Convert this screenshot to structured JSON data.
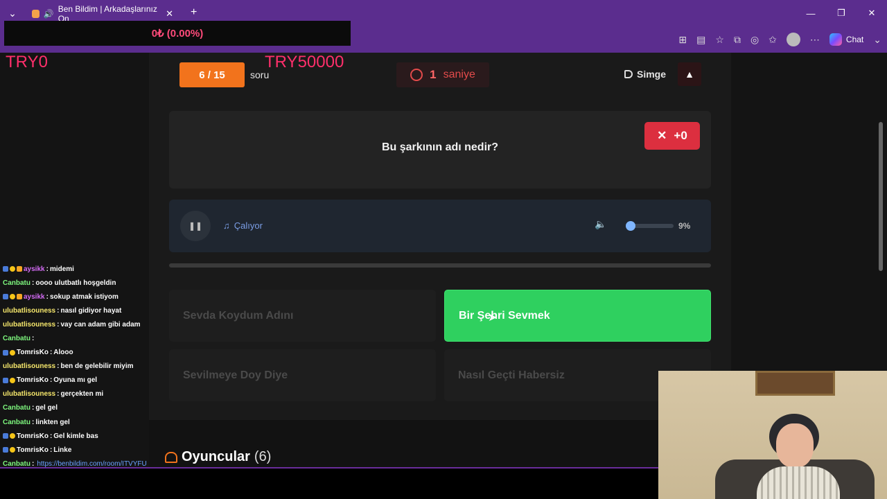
{
  "browser": {
    "tab_title": "Ben Bildim | Arkadaşlarınız On",
    "tab_close": "✕",
    "new_tab": "+",
    "window_controls": [
      "—",
      "❐",
      "✕"
    ],
    "chat_label": "Chat"
  },
  "overlay": {
    "donation_counter": "0₺ (0.00%)",
    "try_left": "TRY0",
    "try_right": "TRY50000"
  },
  "game": {
    "question_counter": "6 / 15",
    "question_word": "soru",
    "timer_value": "1",
    "timer_unit": "saniye",
    "hint_label": "Simge",
    "warning_icon": "▲",
    "question_text": "Bu şarkının adı nedir?",
    "score_symbol": "✕",
    "score_value": "+0",
    "player_status": "Çalıyor",
    "volume_percent_label": "9%",
    "volume_level": 9,
    "answers": [
      {
        "label": "Sevda Koydum Adını",
        "correct": false
      },
      {
        "label": "Bir Şehri Sevmek",
        "correct": true
      },
      {
        "label": "Sevilmeye Doy Diye",
        "correct": false
      },
      {
        "label": "Nasıl Geçti Habersiz",
        "correct": false
      }
    ],
    "players_title": "Oyuncular",
    "players_count": "(6)"
  },
  "chat": [
    {
      "user": "aysikk",
      "color": "pink",
      "badges": [
        "b",
        "y",
        "m"
      ],
      "msg": "midemi"
    },
    {
      "user": "Canbatu",
      "color": "green",
      "badges": [],
      "msg": "oooo ulutbatlı hoşgeldin"
    },
    {
      "user": "aysikk",
      "color": "pink",
      "badges": [
        "b",
        "y",
        "m"
      ],
      "msg": "sokup atmak istiyom"
    },
    {
      "user": "ulubatlisouness",
      "color": "yellow",
      "badges": [],
      "msg": "nasıl gidiyor hayat"
    },
    {
      "user": "ulubatlisouness",
      "color": "yellow",
      "badges": [],
      "msg": "vay can adam gibi adam"
    },
    {
      "user": "Canbatu",
      "color": "green",
      "badges": [],
      "msg": ""
    },
    {
      "user": "TomrisKo",
      "color": "white",
      "badges": [
        "b",
        "y"
      ],
      "msg": "Alooo"
    },
    {
      "user": "ulubatlisouness",
      "color": "yellow",
      "badges": [],
      "msg": "ben de gelebilir miyim"
    },
    {
      "user": "TomrisKo",
      "color": "white",
      "badges": [
        "b",
        "y"
      ],
      "msg": "Oyuna mı gel"
    },
    {
      "user": "ulubatlisouness",
      "color": "yellow",
      "badges": [],
      "msg": "gerçekten mi"
    },
    {
      "user": "Canbatu",
      "color": "green",
      "badges": [],
      "msg": "gel gel"
    },
    {
      "user": "Canbatu",
      "color": "green",
      "badges": [],
      "msg": "linkten gel"
    },
    {
      "user": "TomrisKo",
      "color": "white",
      "badges": [
        "b",
        "y"
      ],
      "msg": "Gel kimle bas"
    },
    {
      "user": "TomrisKo",
      "color": "white",
      "badges": [
        "b",
        "y"
      ],
      "msg": "Linke"
    },
    {
      "user": "Canbatu",
      "color": "green",
      "badges": [],
      "msg": "",
      "link": "https://benbildim.com/room/ITVYFU"
    }
  ],
  "colors": {
    "accent_orange": "#f2731c",
    "correct_green": "#2fd05f",
    "error_red": "#dc2f3f",
    "browser_purple": "#5b2d8e",
    "overlay_pink": "#ff2f6b"
  }
}
